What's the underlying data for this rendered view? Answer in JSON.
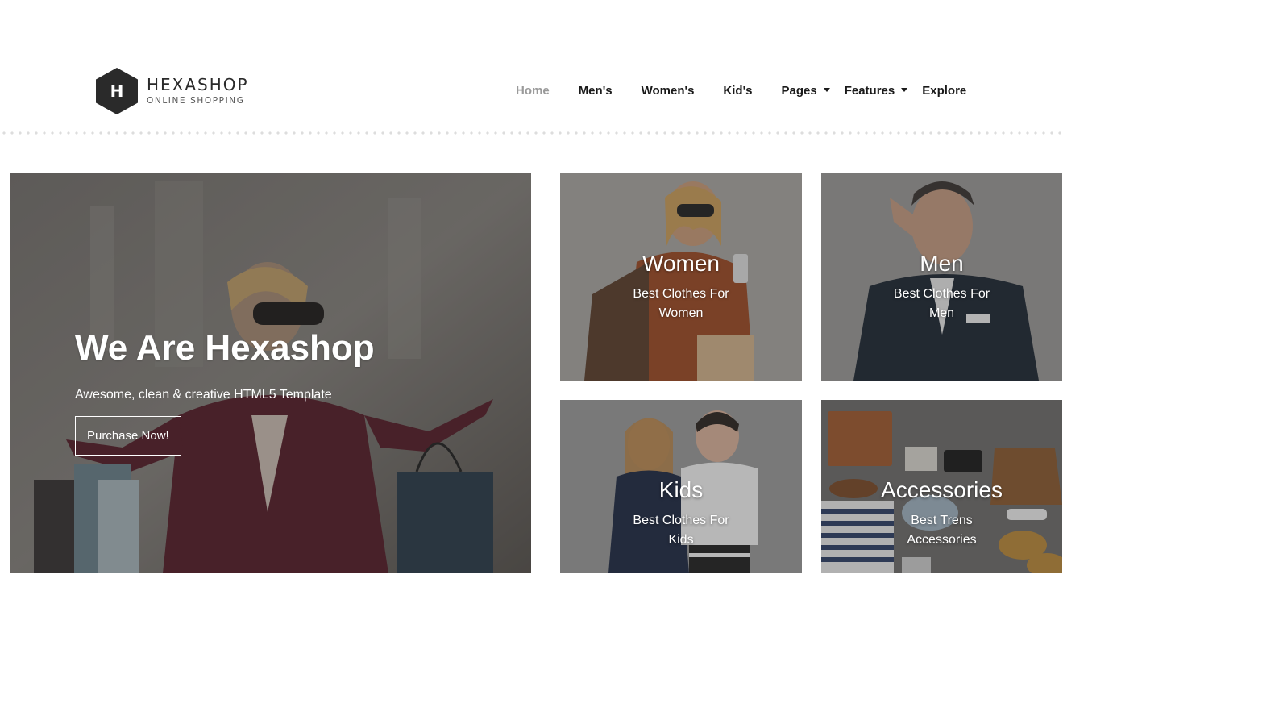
{
  "brand": {
    "logo_letter": "H",
    "name": "HEXASHOP",
    "tagline": "ONLINE SHOPPING"
  },
  "nav": {
    "items": [
      {
        "label": "Home",
        "active": true
      },
      {
        "label": "Men's"
      },
      {
        "label": "Women's"
      },
      {
        "label": "Kid's"
      },
      {
        "label": "Pages",
        "dropdown": true
      },
      {
        "label": "Features",
        "dropdown": true
      },
      {
        "label": "Explore"
      }
    ]
  },
  "banner": {
    "title": "We Are Hexashop",
    "subtitle": "Awesome, clean & creative HTML5 Template",
    "button_label": "Purchase Now!"
  },
  "categories": [
    {
      "title": "Women",
      "description": "Best Clothes For Women"
    },
    {
      "title": "Men",
      "description": "Best Clothes For Men"
    },
    {
      "title": "Kids",
      "description": "Best Clothes For Kids"
    },
    {
      "title": "Accessories",
      "description": "Best Trens Accessories"
    }
  ],
  "colors": {
    "nav_active": "#9a9a9a",
    "nav_text": "#1a1a1a",
    "logo_hex": "#2a2a2a",
    "overlay_text": "#ffffff"
  }
}
